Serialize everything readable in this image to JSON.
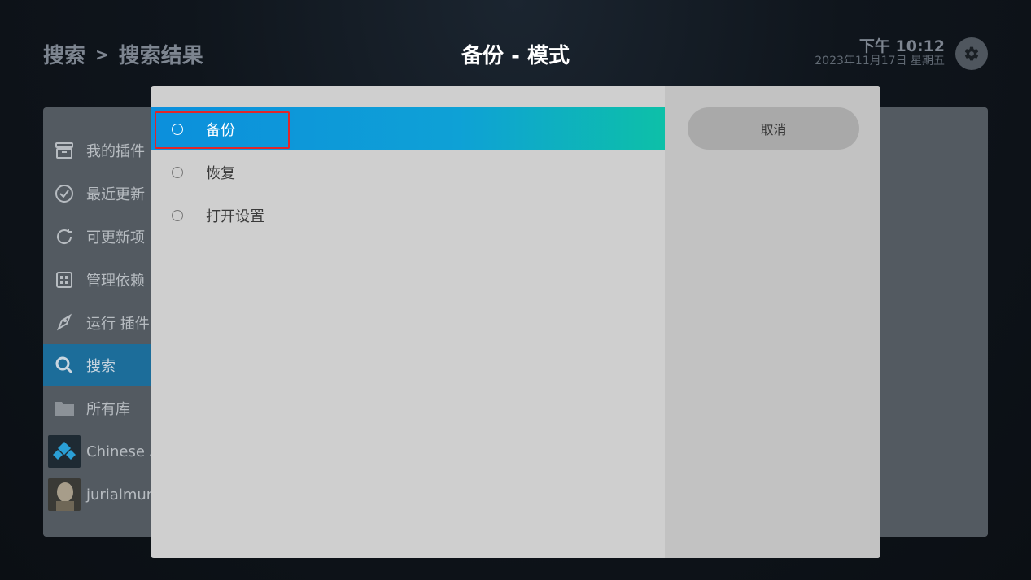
{
  "header": {
    "breadcrumb": [
      "搜索",
      "搜索结果"
    ],
    "breadcrumb_separator": ">",
    "title": "备份 - 模式",
    "time": "下午 10:12",
    "date": "2023年11月17日 星期五"
  },
  "sidebar": {
    "items": [
      {
        "label": "我的插件",
        "icon": "box-icon"
      },
      {
        "label": "最近更新",
        "icon": "clock-check-icon"
      },
      {
        "label": "可更新项 (",
        "icon": "refresh-icon"
      },
      {
        "label": "管理依赖",
        "icon": "grid-icon"
      },
      {
        "label": "运行 插件",
        "icon": "rocket-icon"
      },
      {
        "label": "搜索",
        "icon": "search-icon",
        "active": true
      },
      {
        "label": "所有库",
        "icon": "folder-icon"
      },
      {
        "label": "Chinese A",
        "icon": "addon-thumbnail"
      },
      {
        "label": "jurialmunk",
        "icon": "addon-thumbnail"
      }
    ]
  },
  "dialog": {
    "options": [
      {
        "label": "备份",
        "selected": true
      },
      {
        "label": "恢复",
        "selected": false
      },
      {
        "label": "打开设置",
        "selected": false
      }
    ],
    "cancel_label": "取消"
  },
  "colors": {
    "selected_gradient_start": "#0c8fdc",
    "selected_gradient_end": "#0dc0a8",
    "highlight_border": "#e1262a",
    "active_sidebar": "#1c6d9a"
  }
}
